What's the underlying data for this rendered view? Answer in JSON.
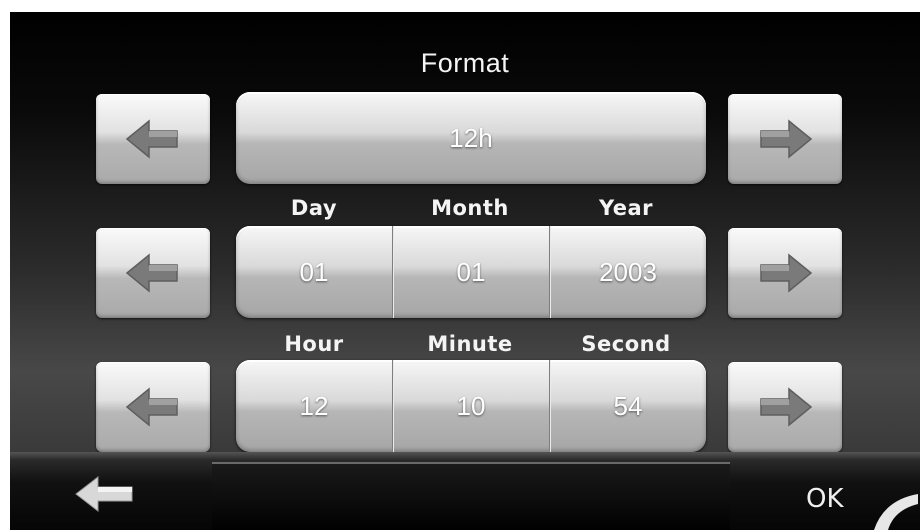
{
  "header": {
    "title": "Format"
  },
  "format_row": {
    "value": "12h"
  },
  "date_row": {
    "labels": {
      "day": "Day",
      "month": "Month",
      "year": "Year"
    },
    "values": {
      "day": "01",
      "month": "01",
      "year": "2003"
    }
  },
  "time_row": {
    "labels": {
      "hour": "Hour",
      "minute": "Minute",
      "second": "Second"
    },
    "values": {
      "hour": "12",
      "minute": "10",
      "second": "54"
    }
  },
  "footer": {
    "ok_label": "OK"
  },
  "icons": {
    "left": "arrow-left-icon",
    "right": "arrow-right-icon",
    "back": "back-arrow-icon"
  },
  "colors": {
    "button_light": "#fafafa",
    "button_dark": "#a9a9a9",
    "arrow": "#7a7a7a",
    "text": "#ffffff"
  }
}
